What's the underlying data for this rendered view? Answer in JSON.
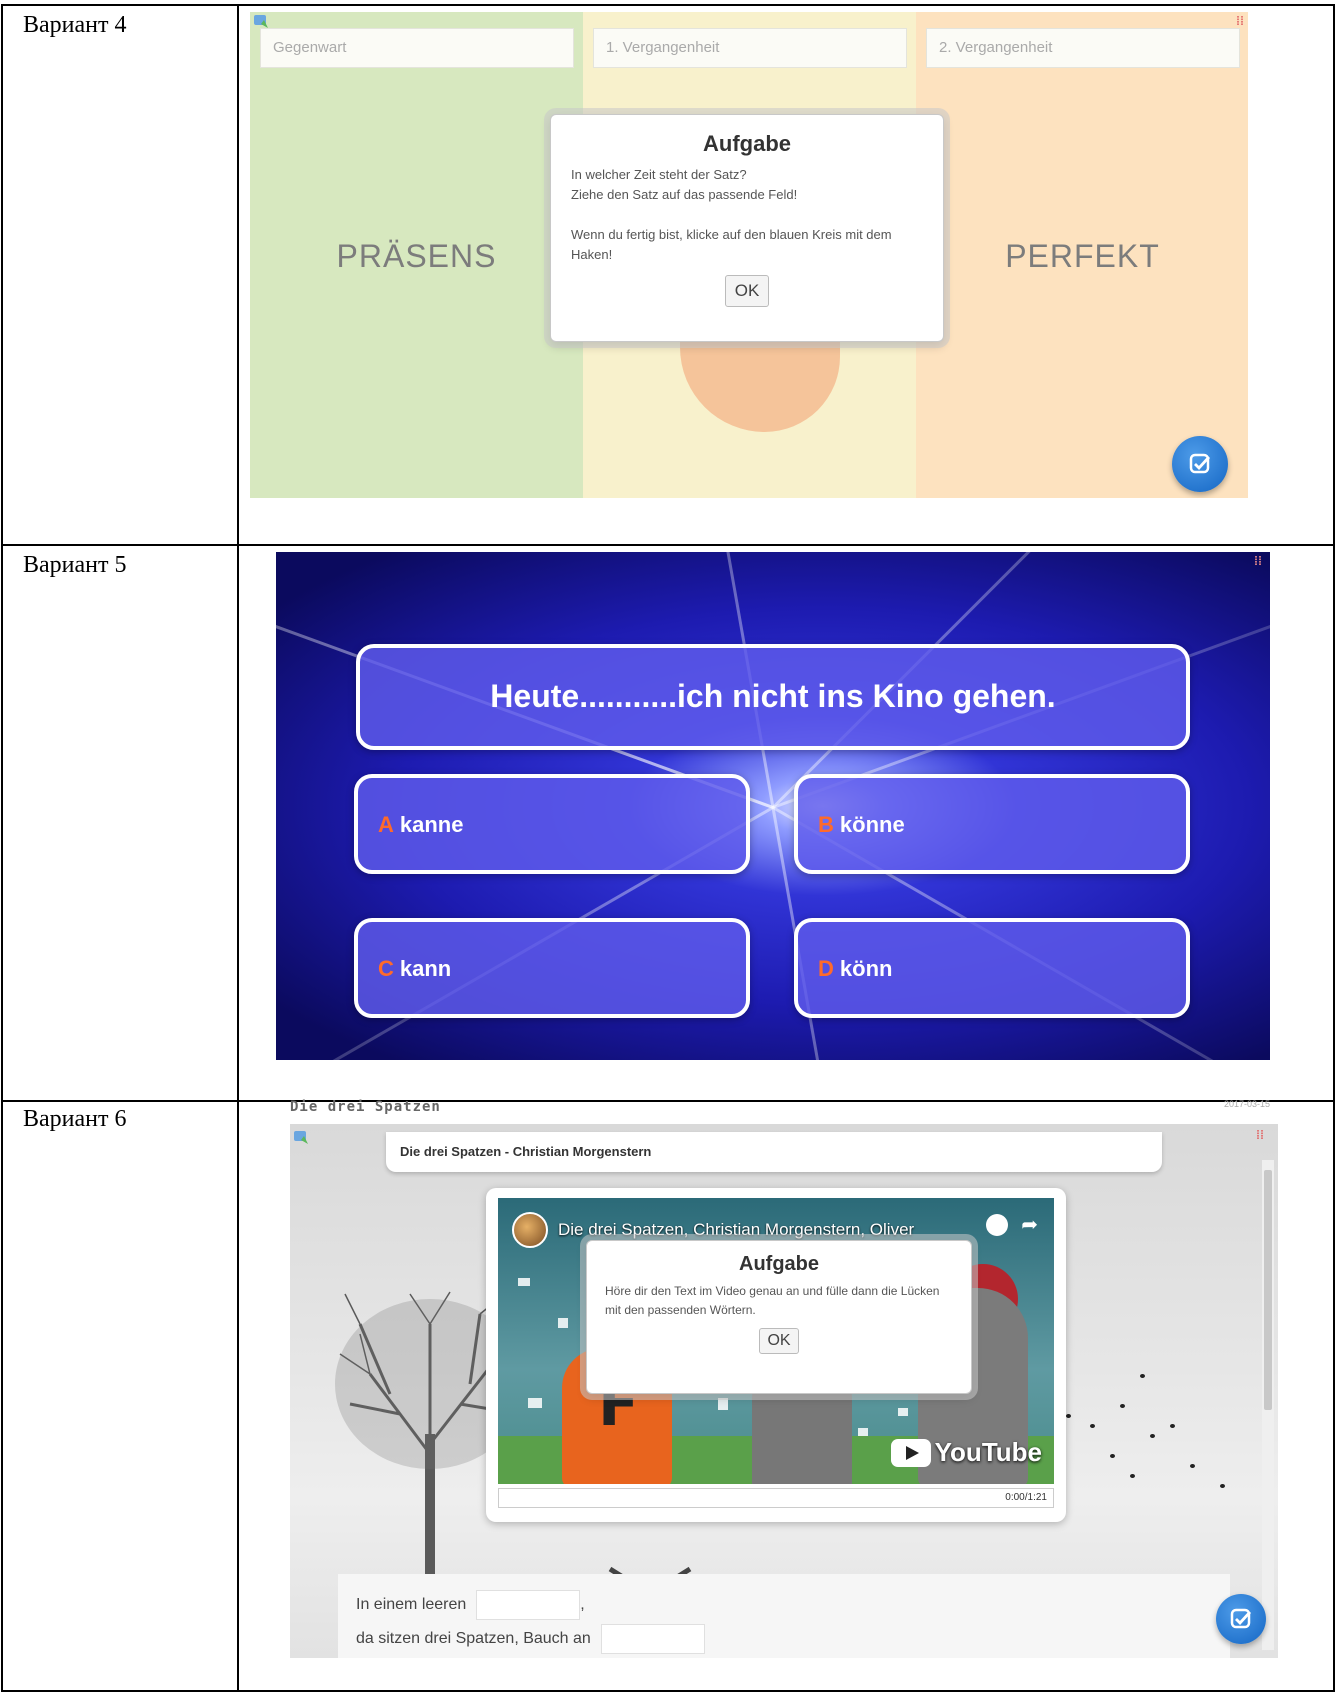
{
  "rows": [
    {
      "label": "Вариант 4"
    },
    {
      "label": "Вариант 5"
    },
    {
      "label": "Вариант 6"
    }
  ],
  "v4": {
    "slots": [
      "Gegenwart",
      "1. Vergangenheit",
      "2. Vergangenheit"
    ],
    "big_labels": {
      "left": "PRÄSENS",
      "right": "PERFEKT"
    },
    "dialog": {
      "title": "Aufgabe",
      "line1": "In welcher Zeit steht der Satz?",
      "line2": "Ziehe den Satz auf das passende Feld!",
      "line3": "Wenn du fertig bist, klicke auf den blauen Kreis mit dem Haken!",
      "ok": "OK"
    },
    "colors": {
      "green": "#d7e8bf",
      "yellow": "#f8f1cc",
      "orange": "#fde2bf",
      "fab": "#1f74d1"
    },
    "icons": [
      "help-icon",
      "fullscreen-icon",
      "check-icon"
    ]
  },
  "v5": {
    "question": "Heute...........ich nicht ins Kino gehen.",
    "answers": [
      {
        "letter": "A",
        "text": "kanne"
      },
      {
        "letter": "B",
        "text": "könne"
      },
      {
        "letter": "C",
        "text": "kann"
      },
      {
        "letter": "D",
        "text": "könn"
      }
    ],
    "colors": {
      "letter": "#ff6a2a",
      "box": "#5f5ceb",
      "background": "#1d1bb0"
    }
  },
  "v6": {
    "header": "Die drei Spatzen",
    "date": "2017-03-15",
    "title": "Die drei Spatzen - Christian Morgenstern",
    "video": {
      "title": "Die drei Spatzen, Christian Morgenstern, Oliver",
      "progress": "0:00/1:21",
      "logo": "YouTube"
    },
    "dialog": {
      "title": "Aufgabe",
      "text": "Höre dir den Text im Video genau an und fülle dann die Lücken mit den passenden Wörtern.",
      "ok": "OK"
    },
    "text_lines": [
      {
        "before": "In einem leeren",
        "after": ","
      },
      {
        "before": "da sitzen drei Spatzen, Bauch an",
        "after": ""
      }
    ]
  }
}
